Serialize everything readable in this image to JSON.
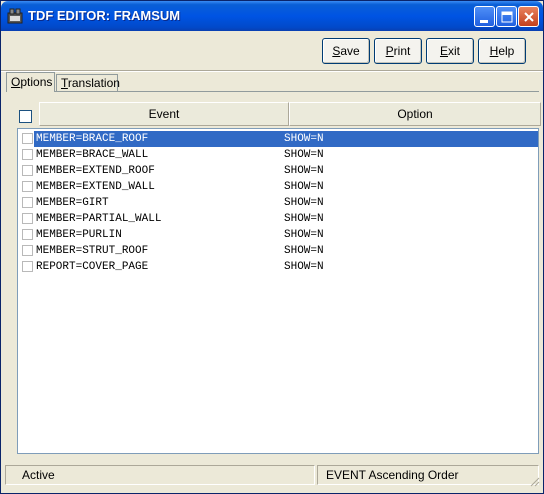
{
  "window": {
    "title": "TDF EDITOR: FRAMSUM"
  },
  "toolbar": {
    "save": {
      "pre": "",
      "key": "S",
      "post": "ave"
    },
    "print": {
      "pre": "",
      "key": "P",
      "post": "rint"
    },
    "exit": {
      "pre": "",
      "key": "E",
      "post": "xit"
    },
    "help": {
      "pre": "",
      "key": "H",
      "post": "elp"
    }
  },
  "tabs": {
    "options": {
      "pre": "",
      "key": "O",
      "post": "ptions"
    },
    "translation": {
      "pre": "",
      "key": "T",
      "post": "ranslation"
    }
  },
  "table": {
    "columns": {
      "event": "Event",
      "option": "Option"
    },
    "rows": [
      {
        "event": "MEMBER=BRACE_ROOF",
        "option": "SHOW=N",
        "selected": true
      },
      {
        "event": "MEMBER=BRACE_WALL",
        "option": "SHOW=N"
      },
      {
        "event": "MEMBER=EXTEND_ROOF",
        "option": "SHOW=N"
      },
      {
        "event": "MEMBER=EXTEND_WALL",
        "option": "SHOW=N"
      },
      {
        "event": "MEMBER=GIRT",
        "option": "SHOW=N"
      },
      {
        "event": "MEMBER=PARTIAL_WALL",
        "option": "SHOW=N"
      },
      {
        "event": "MEMBER=PURLIN",
        "option": "SHOW=N"
      },
      {
        "event": "MEMBER=STRUT_ROOF",
        "option": "SHOW=N"
      },
      {
        "event": "REPORT=COVER_PAGE",
        "option": "SHOW=N"
      }
    ]
  },
  "status": {
    "left": "Active",
    "right": "EVENT Ascending Order"
  },
  "colors": {
    "titlebar": "#0054e3",
    "selection": "#316ac5",
    "face": "#ece9d8"
  }
}
